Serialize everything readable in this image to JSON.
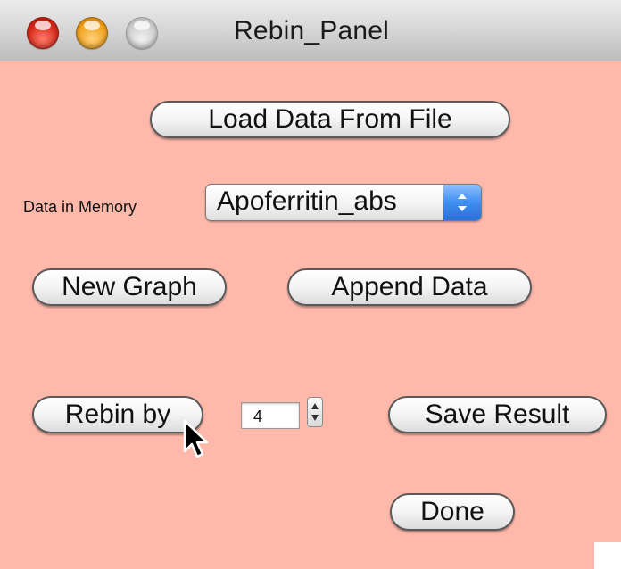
{
  "window": {
    "title": "Rebin_Panel"
  },
  "buttons": {
    "load_data": "Load Data From File",
    "new_graph": "New Graph",
    "append_data": "Append Data",
    "rebin_by": "Rebin by",
    "save_result": "Save Result",
    "done": "Done"
  },
  "data_in_memory": {
    "label": "Data in Memory",
    "selected": "Apoferritin_abs"
  },
  "rebin": {
    "value": "4"
  },
  "colors": {
    "panel_background": "#ffb9ab",
    "popup_arrow": "#3f8ef2"
  },
  "icons": {
    "close": "close-icon",
    "minimize": "minimize-icon",
    "zoom": "zoom-icon",
    "popup_arrows": "up-down-arrows-icon",
    "stepper": "stepper-arrows-icon",
    "cursor": "mouse-pointer-icon"
  }
}
